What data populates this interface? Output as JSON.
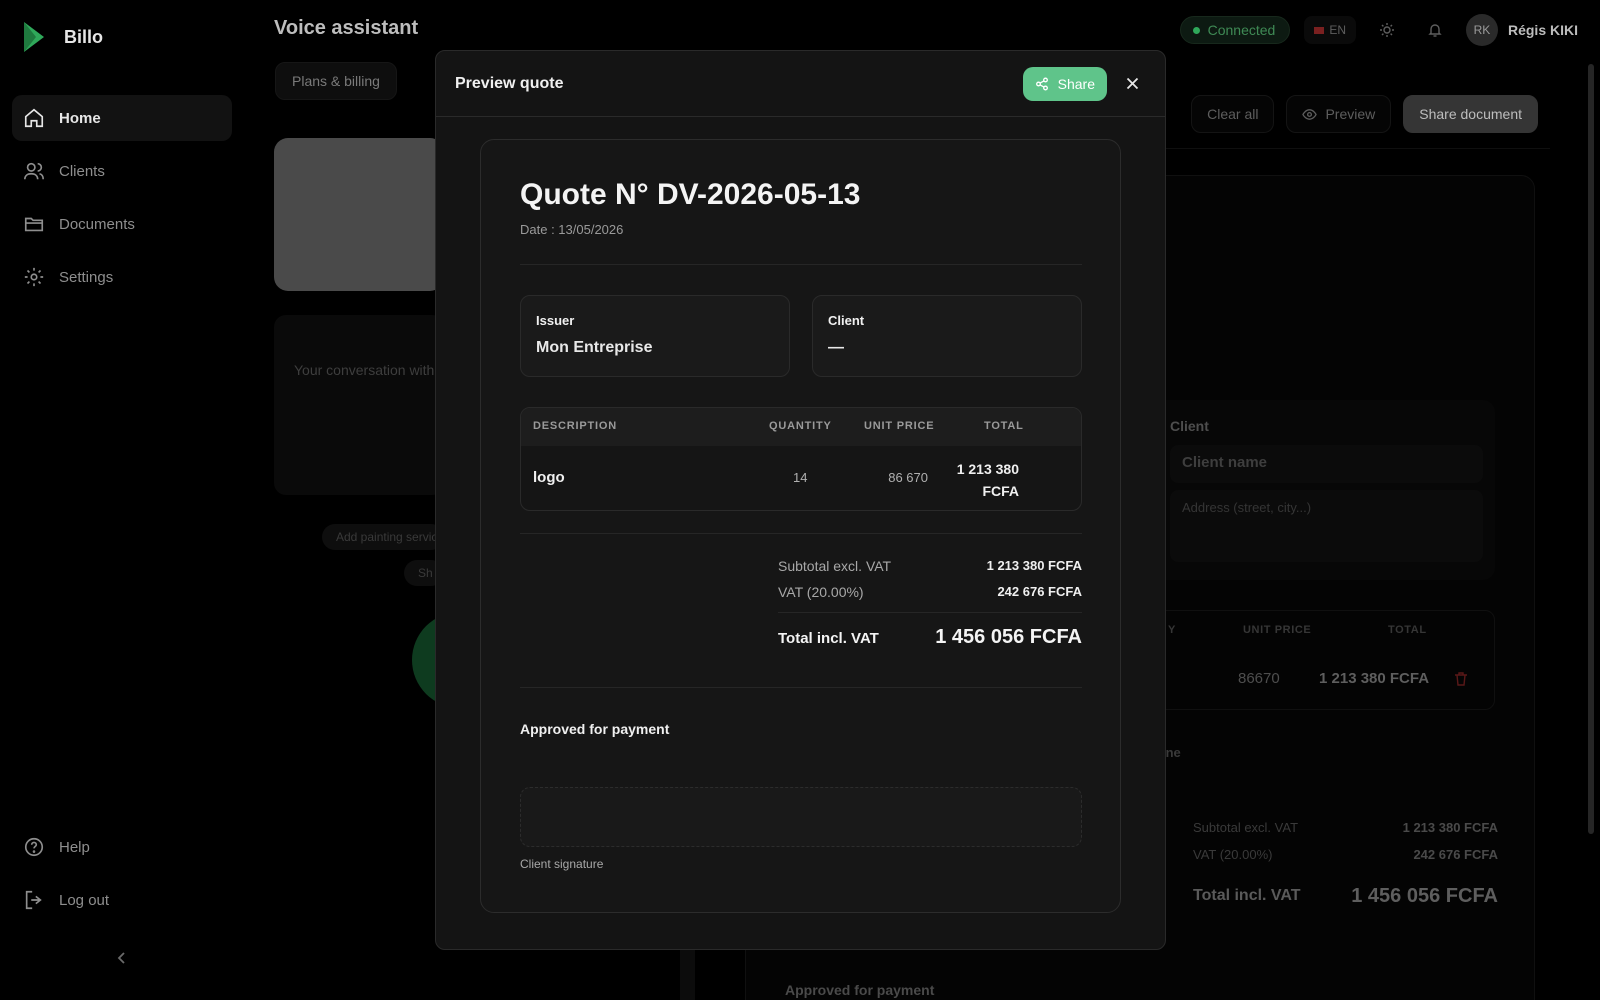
{
  "brand": {
    "name": "Billo"
  },
  "sidebar": {
    "items": [
      {
        "label": "Home",
        "icon": "home-icon",
        "active": true
      },
      {
        "label": "Clients",
        "icon": "users-icon"
      },
      {
        "label": "Documents",
        "icon": "folder-icon"
      },
      {
        "label": "Settings",
        "icon": "gear-icon"
      }
    ],
    "bottom": [
      {
        "label": "Help",
        "icon": "help-icon"
      },
      {
        "label": "Log out",
        "icon": "logout-icon"
      }
    ]
  },
  "header": {
    "title": "Voice assistant",
    "status": "Connected",
    "language": "EN",
    "user": {
      "initials": "RK",
      "name": "Régis KIKI"
    }
  },
  "background": {
    "tab": "Plans & billing",
    "conversation_text": "Your conversation with",
    "suggestion_chip": "Add painting services",
    "chip2": "Sh",
    "toolbar": {
      "clear": "Clear all",
      "preview": "Preview",
      "share": "Share document"
    },
    "client_label": "Client",
    "client_placeholder": "Client name",
    "address_placeholder": "Address (street, city...)",
    "table_headers": {
      "qty": "Y",
      "unit_price": "UNIT PRICE",
      "total": "TOTAL"
    },
    "row": {
      "unit_price": "86670",
      "total": "1 213 380 FCFA"
    },
    "add_line": "ine",
    "totals": {
      "subtotal_label": "Subtotal excl. VAT",
      "subtotal": "1 213 380 FCFA",
      "vat_label": "VAT (20.00%)",
      "vat": "242 676 FCFA",
      "grand_label": "Total incl. VAT",
      "grand": "1 456 056 FCFA"
    },
    "approved": "Approved for payment"
  },
  "modal": {
    "title": "Preview quote",
    "share_label": "Share",
    "quote": {
      "title": "Quote N° DV-2026-05-13",
      "date": "Date : 13/05/2026",
      "issuer_label": "Issuer",
      "issuer": "Mon Entreprise",
      "client_label": "Client",
      "client": "—",
      "columns": [
        "DESCRIPTION",
        "QUANTITY",
        "UNIT PRICE",
        "TOTAL"
      ],
      "rows": [
        {
          "description": "logo",
          "quantity": "14",
          "unit_price": "86 670",
          "total_line1": "1 213 380",
          "total_line2": "FCFA"
        }
      ],
      "subtotal_label": "Subtotal excl. VAT",
      "subtotal": "1 213 380 FCFA",
      "vat_label": "VAT (20.00%)",
      "vat": "242 676 FCFA",
      "grand_label": "Total incl. VAT",
      "grand": "1 456 056 FCFA",
      "approved": "Approved for payment",
      "signature_label": "Client signature"
    }
  },
  "colors": {
    "accent": "#5fc48a",
    "status": "#2fa85a",
    "surface": "#141414"
  }
}
